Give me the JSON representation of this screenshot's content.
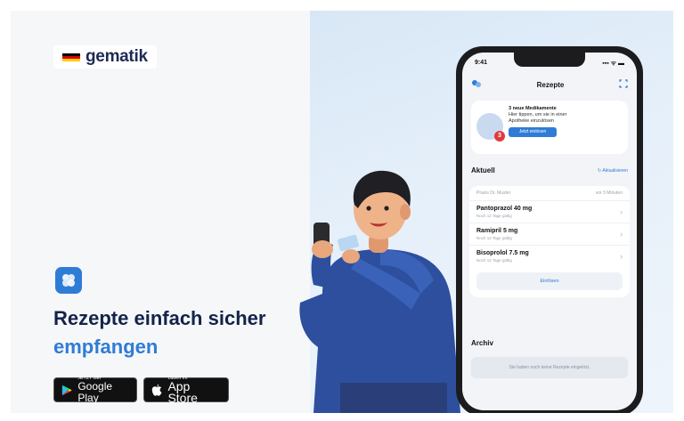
{
  "brand": {
    "name": "gematik",
    "flag_colors": [
      "#000000",
      "#dd0000",
      "#ffce00"
    ]
  },
  "headline": {
    "line1": "Rezepte einfach sicher",
    "line2": "empfangen"
  },
  "stores": {
    "google_small": "JETZT BEI",
    "google_big": "Google Play",
    "apple_small": "Laden im",
    "apple_big": "App Store"
  },
  "phone": {
    "time": "9:41",
    "signal": "▪▪▪ ᯤ ▬",
    "title": "Rezepte",
    "promo": {
      "title": "3 neue Medikamente",
      "text1": "Hier tippen, um sie in einer",
      "text2": "Apotheke einzulösen",
      "button": "Jetzt einlösen",
      "badge": "3"
    },
    "current": {
      "title": "Aktuell",
      "link": "Aktualisieren",
      "practice": "Praxis Dr. Muster",
      "time_ago": "vor 3 Minuten",
      "items": [
        {
          "name": "Pantoprazol 40 mg",
          "sub": "Noch 12 Tage gültig"
        },
        {
          "name": "Ramipril 5 mg",
          "sub": "Noch 12 Tage gültig"
        },
        {
          "name": "Bisoprolol 7.5 mg",
          "sub": "Noch 12 Tage gültig"
        }
      ],
      "button": "Einlösen"
    },
    "archive": {
      "title": "Archiv",
      "empty": "Sie haben noch keine Rezepte eingelöst."
    }
  },
  "colors": {
    "accent": "#2f7cd6",
    "navy": "#13234a"
  },
  "icons": {
    "app": "app-icon",
    "google_play": "google-play-icon",
    "apple": "apple-icon",
    "profile": "profile-icon",
    "scan": "scan-icon",
    "refresh": "refresh-icon",
    "chevron": "chevron-right-icon"
  }
}
